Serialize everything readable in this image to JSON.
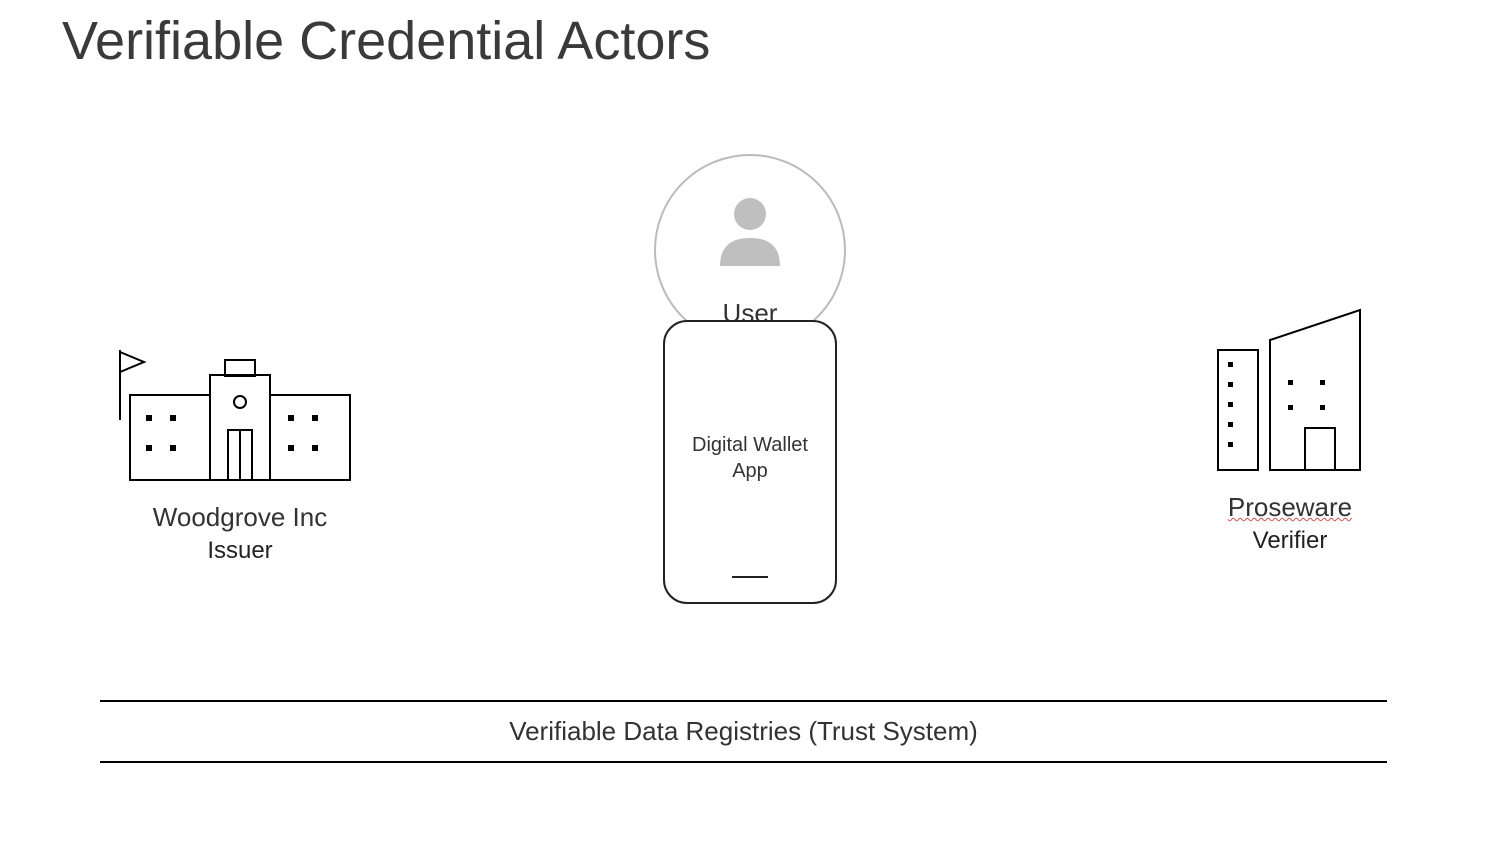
{
  "title": "Verifiable Credential Actors",
  "issuer": {
    "name": "Woodgrove Inc",
    "role": "Issuer"
  },
  "holder": {
    "label": "User (holder)",
    "app_line1": "Digital Wallet",
    "app_line2": "App"
  },
  "verifier": {
    "name": "Proseware",
    "role": "Verifier"
  },
  "registry": {
    "label": "Verifiable Data Registries (Trust System)"
  }
}
